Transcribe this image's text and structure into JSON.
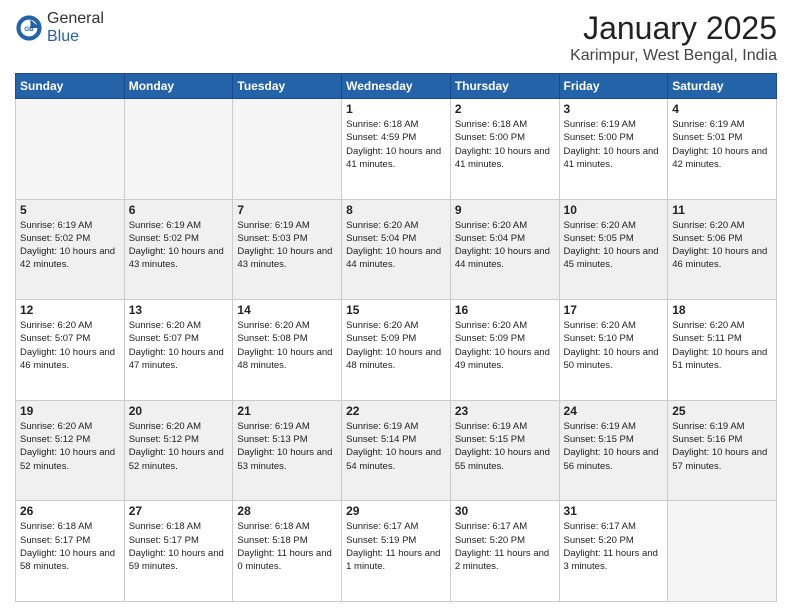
{
  "logo": {
    "general": "General",
    "blue": "Blue"
  },
  "title": "January 2025",
  "location": "Karimpur, West Bengal, India",
  "weekdays": [
    "Sunday",
    "Monday",
    "Tuesday",
    "Wednesday",
    "Thursday",
    "Friday",
    "Saturday"
  ],
  "weeks": [
    [
      {
        "day": "",
        "empty": true
      },
      {
        "day": "",
        "empty": true
      },
      {
        "day": "",
        "empty": true
      },
      {
        "day": "1",
        "sunrise": "Sunrise: 6:18 AM",
        "sunset": "Sunset: 4:59 PM",
        "daylight": "Daylight: 10 hours and 41 minutes."
      },
      {
        "day": "2",
        "sunrise": "Sunrise: 6:18 AM",
        "sunset": "Sunset: 5:00 PM",
        "daylight": "Daylight: 10 hours and 41 minutes."
      },
      {
        "day": "3",
        "sunrise": "Sunrise: 6:19 AM",
        "sunset": "Sunset: 5:00 PM",
        "daylight": "Daylight: 10 hours and 41 minutes."
      },
      {
        "day": "4",
        "sunrise": "Sunrise: 6:19 AM",
        "sunset": "Sunset: 5:01 PM",
        "daylight": "Daylight: 10 hours and 42 minutes."
      }
    ],
    [
      {
        "day": "5",
        "sunrise": "Sunrise: 6:19 AM",
        "sunset": "Sunset: 5:02 PM",
        "daylight": "Daylight: 10 hours and 42 minutes."
      },
      {
        "day": "6",
        "sunrise": "Sunrise: 6:19 AM",
        "sunset": "Sunset: 5:02 PM",
        "daylight": "Daylight: 10 hours and 43 minutes."
      },
      {
        "day": "7",
        "sunrise": "Sunrise: 6:19 AM",
        "sunset": "Sunset: 5:03 PM",
        "daylight": "Daylight: 10 hours and 43 minutes."
      },
      {
        "day": "8",
        "sunrise": "Sunrise: 6:20 AM",
        "sunset": "Sunset: 5:04 PM",
        "daylight": "Daylight: 10 hours and 44 minutes."
      },
      {
        "day": "9",
        "sunrise": "Sunrise: 6:20 AM",
        "sunset": "Sunset: 5:04 PM",
        "daylight": "Daylight: 10 hours and 44 minutes."
      },
      {
        "day": "10",
        "sunrise": "Sunrise: 6:20 AM",
        "sunset": "Sunset: 5:05 PM",
        "daylight": "Daylight: 10 hours and 45 minutes."
      },
      {
        "day": "11",
        "sunrise": "Sunrise: 6:20 AM",
        "sunset": "Sunset: 5:06 PM",
        "daylight": "Daylight: 10 hours and 46 minutes."
      }
    ],
    [
      {
        "day": "12",
        "sunrise": "Sunrise: 6:20 AM",
        "sunset": "Sunset: 5:07 PM",
        "daylight": "Daylight: 10 hours and 46 minutes."
      },
      {
        "day": "13",
        "sunrise": "Sunrise: 6:20 AM",
        "sunset": "Sunset: 5:07 PM",
        "daylight": "Daylight: 10 hours and 47 minutes."
      },
      {
        "day": "14",
        "sunrise": "Sunrise: 6:20 AM",
        "sunset": "Sunset: 5:08 PM",
        "daylight": "Daylight: 10 hours and 48 minutes."
      },
      {
        "day": "15",
        "sunrise": "Sunrise: 6:20 AM",
        "sunset": "Sunset: 5:09 PM",
        "daylight": "Daylight: 10 hours and 48 minutes."
      },
      {
        "day": "16",
        "sunrise": "Sunrise: 6:20 AM",
        "sunset": "Sunset: 5:09 PM",
        "daylight": "Daylight: 10 hours and 49 minutes."
      },
      {
        "day": "17",
        "sunrise": "Sunrise: 6:20 AM",
        "sunset": "Sunset: 5:10 PM",
        "daylight": "Daylight: 10 hours and 50 minutes."
      },
      {
        "day": "18",
        "sunrise": "Sunrise: 6:20 AM",
        "sunset": "Sunset: 5:11 PM",
        "daylight": "Daylight: 10 hours and 51 minutes."
      }
    ],
    [
      {
        "day": "19",
        "sunrise": "Sunrise: 6:20 AM",
        "sunset": "Sunset: 5:12 PM",
        "daylight": "Daylight: 10 hours and 52 minutes."
      },
      {
        "day": "20",
        "sunrise": "Sunrise: 6:20 AM",
        "sunset": "Sunset: 5:12 PM",
        "daylight": "Daylight: 10 hours and 52 minutes."
      },
      {
        "day": "21",
        "sunrise": "Sunrise: 6:19 AM",
        "sunset": "Sunset: 5:13 PM",
        "daylight": "Daylight: 10 hours and 53 minutes."
      },
      {
        "day": "22",
        "sunrise": "Sunrise: 6:19 AM",
        "sunset": "Sunset: 5:14 PM",
        "daylight": "Daylight: 10 hours and 54 minutes."
      },
      {
        "day": "23",
        "sunrise": "Sunrise: 6:19 AM",
        "sunset": "Sunset: 5:15 PM",
        "daylight": "Daylight: 10 hours and 55 minutes."
      },
      {
        "day": "24",
        "sunrise": "Sunrise: 6:19 AM",
        "sunset": "Sunset: 5:15 PM",
        "daylight": "Daylight: 10 hours and 56 minutes."
      },
      {
        "day": "25",
        "sunrise": "Sunrise: 6:19 AM",
        "sunset": "Sunset: 5:16 PM",
        "daylight": "Daylight: 10 hours and 57 minutes."
      }
    ],
    [
      {
        "day": "26",
        "sunrise": "Sunrise: 6:18 AM",
        "sunset": "Sunset: 5:17 PM",
        "daylight": "Daylight: 10 hours and 58 minutes."
      },
      {
        "day": "27",
        "sunrise": "Sunrise: 6:18 AM",
        "sunset": "Sunset: 5:17 PM",
        "daylight": "Daylight: 10 hours and 59 minutes."
      },
      {
        "day": "28",
        "sunrise": "Sunrise: 6:18 AM",
        "sunset": "Sunset: 5:18 PM",
        "daylight": "Daylight: 11 hours and 0 minutes."
      },
      {
        "day": "29",
        "sunrise": "Sunrise: 6:17 AM",
        "sunset": "Sunset: 5:19 PM",
        "daylight": "Daylight: 11 hours and 1 minute."
      },
      {
        "day": "30",
        "sunrise": "Sunrise: 6:17 AM",
        "sunset": "Sunset: 5:20 PM",
        "daylight": "Daylight: 11 hours and 2 minutes."
      },
      {
        "day": "31",
        "sunrise": "Sunrise: 6:17 AM",
        "sunset": "Sunset: 5:20 PM",
        "daylight": "Daylight: 11 hours and 3 minutes."
      },
      {
        "day": "",
        "empty": true
      }
    ]
  ]
}
